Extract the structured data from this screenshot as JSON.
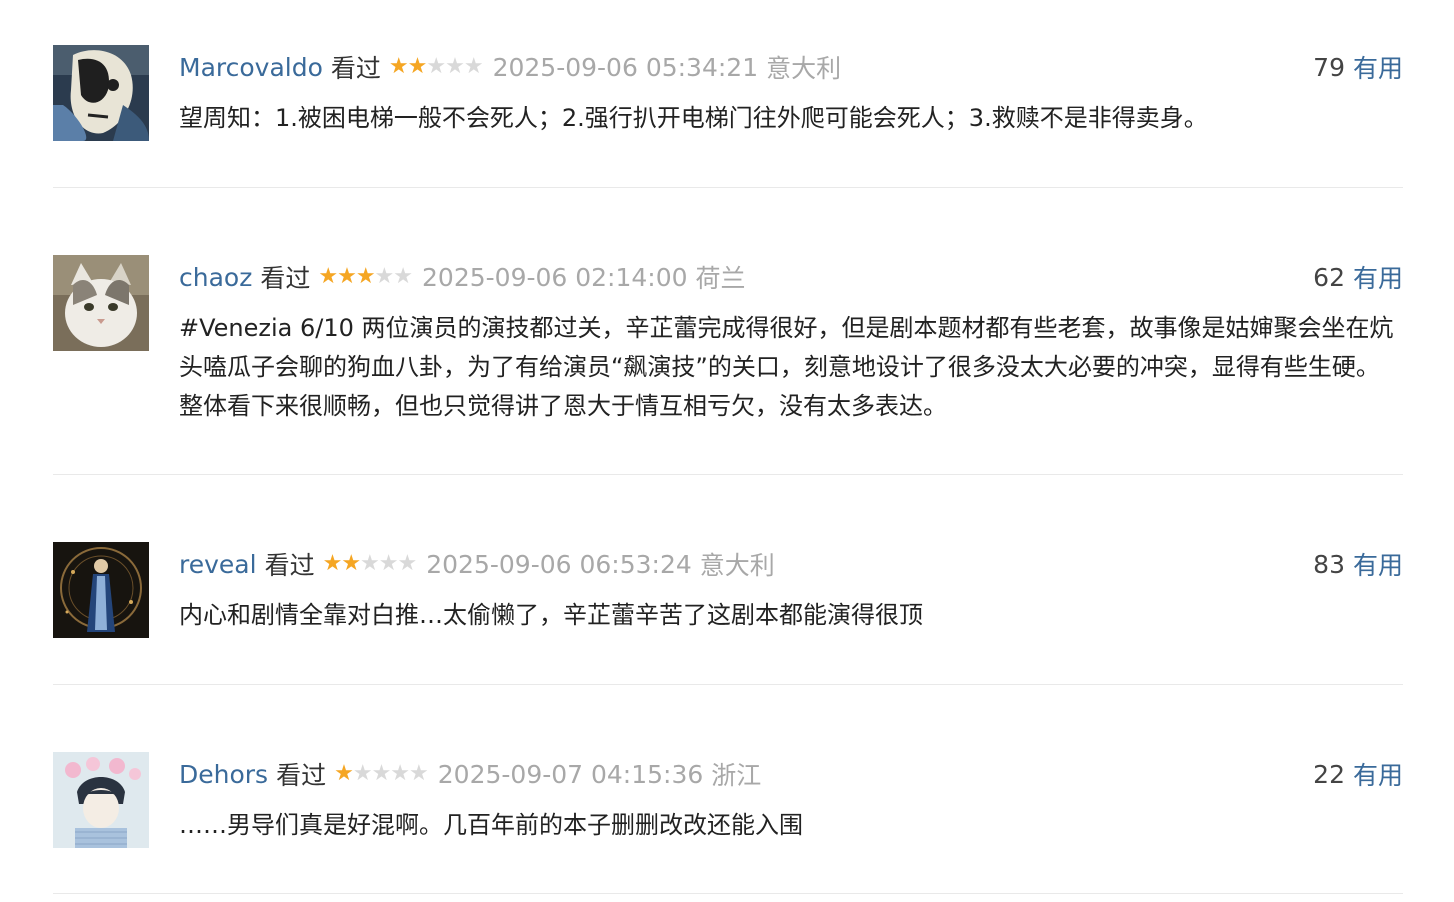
{
  "comments": [
    {
      "username": "Marcovaldo",
      "status": "看过",
      "rating": 2,
      "time": "2025-09-06 05:34:21",
      "location": "意大利",
      "votes": "79",
      "vote_label": "有用",
      "text": "望周知：1.被困电梯一般不会死人；2.强行扒开电梯门往外爬可能会死人；3.救赎不是非得卖身。",
      "avatar_icon": "portrait-avatar"
    },
    {
      "username": "chaoz",
      "status": "看过",
      "rating": 3,
      "time": "2025-09-06 02:14:00",
      "location": "荷兰",
      "votes": "62",
      "vote_label": "有用",
      "text": "#Venezia 6/10 两位演员的演技都过关，辛芷蕾完成得很好，但是剧本题材都有些老套，故事像是姑婶聚会坐在炕头嗑瓜子会聊的狗血八卦，为了有给演员“飙演技”的关口，刻意地设计了很多没太大必要的冲突，显得有些生硬。整体看下来很顺畅，但也只觉得讲了恩大于情互相亏欠，没有太多表达。",
      "avatar_icon": "cat-avatar"
    },
    {
      "username": "reveal",
      "status": "看过",
      "rating": 2,
      "time": "2025-09-06 06:53:24",
      "location": "意大利",
      "votes": "83",
      "vote_label": "有用",
      "text": "内心和剧情全靠对白推…太偷懒了，辛芷蕾辛苦了这剧本都能演得很顶",
      "avatar_icon": "figure-avatar"
    },
    {
      "username": "Dehors",
      "status": "看过",
      "rating": 1,
      "time": "2025-09-07 04:15:36",
      "location": "浙江",
      "votes": "22",
      "vote_label": "有用",
      "text": "……男导们真是好混啊。几百年前的本子删删改改还能入围",
      "avatar_icon": "anime-boy-avatar"
    }
  ],
  "colors": {
    "link": "#3a6a9a",
    "star_on": "#f5a623",
    "star_off": "#d9d9d9",
    "muted": "#a8a8a8",
    "divider": "#e9e9e9"
  }
}
